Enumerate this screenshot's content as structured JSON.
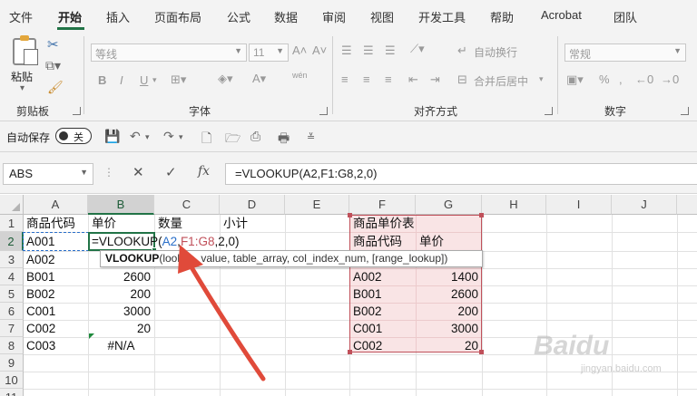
{
  "menu": {
    "tabs": [
      "文件",
      "开始",
      "插入",
      "页面布局",
      "公式",
      "数据",
      "审阅",
      "视图",
      "开发工具",
      "帮助",
      "Acrobat",
      "团队"
    ],
    "active": "开始"
  },
  "ribbon": {
    "clipboard": {
      "paste_label": "粘贴",
      "group_label": "剪贴板"
    },
    "font": {
      "font_name": "等线",
      "font_size": "11",
      "bold": "B",
      "italic": "I",
      "underline": "U",
      "phonetic": "wén",
      "group_label": "字体"
    },
    "alignment": {
      "wrap_text": "自动换行",
      "merge_center": "合并后居中",
      "group_label": "对齐方式"
    },
    "number": {
      "format": "常规",
      "group_label": "数字"
    }
  },
  "qat": {
    "autosave_label": "自动保存",
    "autosave_state": "关"
  },
  "formula_bar": {
    "name_box": "ABS",
    "cancel_icon": "✕",
    "enter_icon": "✓",
    "fx_label": "fx",
    "formula": "=VLOOKUP(A2,F1:G8,2,0)"
  },
  "grid": {
    "columns": [
      "A",
      "B",
      "C",
      "D",
      "E",
      "F",
      "G",
      "H",
      "I",
      "J"
    ],
    "rows": [
      "1",
      "2",
      "3",
      "4",
      "5",
      "6",
      "7",
      "8",
      "9",
      "10",
      "11"
    ],
    "a_col": [
      "商品代码",
      "A001",
      "A002",
      "B001",
      "B002",
      "C001",
      "C002",
      "C003"
    ],
    "b_col": [
      "单价",
      "",
      "",
      "2600",
      "200",
      "3000",
      "20",
      "#N/A"
    ],
    "c1": "数量",
    "d1": "小计",
    "f_col": [
      "商品单价表",
      "商品代码",
      "",
      "A002",
      "B001",
      "B002",
      "C001",
      "C002"
    ],
    "g_col": [
      "",
      "单价",
      ")",
      "1400",
      "2600",
      "200",
      "3000",
      "20"
    ],
    "editing": {
      "func": "=VLOOKUP(",
      "ref1": "A2",
      "comma1": ",",
      "ref2": "F1:G8",
      "rest": ",2,0)"
    },
    "tooltip": {
      "func": "VLOOKUP",
      "args": "(lookup_value, table_array, col_index_num, [range_lookup])"
    }
  },
  "watermark": {
    "text": "Baidu",
    "sub": "jingyan.baidu.com"
  },
  "colors": {
    "accent": "#217346",
    "ref_blue": "#2a6fc9",
    "ref_red": "#c0505a",
    "arrow": "#e04a3a"
  }
}
